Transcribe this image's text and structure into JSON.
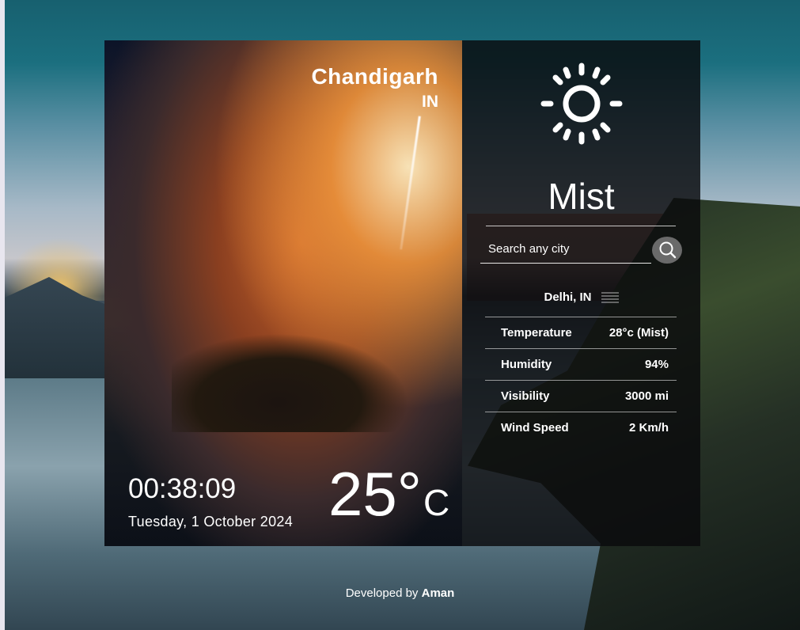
{
  "location": {
    "city": "Chandigarh",
    "country": "IN"
  },
  "clock": {
    "time": "00:38:09",
    "date": "Tuesday, 1 October 2024"
  },
  "current": {
    "temperature": "25°",
    "unit": "C"
  },
  "weather": {
    "condition": "Mist",
    "icon": "sun-icon"
  },
  "search": {
    "placeholder": "Search any city",
    "button_icon": "search-icon"
  },
  "details": {
    "title": "Delhi, IN",
    "rows": [
      {
        "label": "Temperature",
        "value": "28°c (Mist)"
      },
      {
        "label": "Humidity",
        "value": "94%"
      },
      {
        "label": "Visibility",
        "value": "3000 mi"
      },
      {
        "label": "Wind Speed",
        "value": "2 Km/h"
      }
    ]
  },
  "footer": {
    "prefix": "Developed by",
    "author": "Aman"
  }
}
